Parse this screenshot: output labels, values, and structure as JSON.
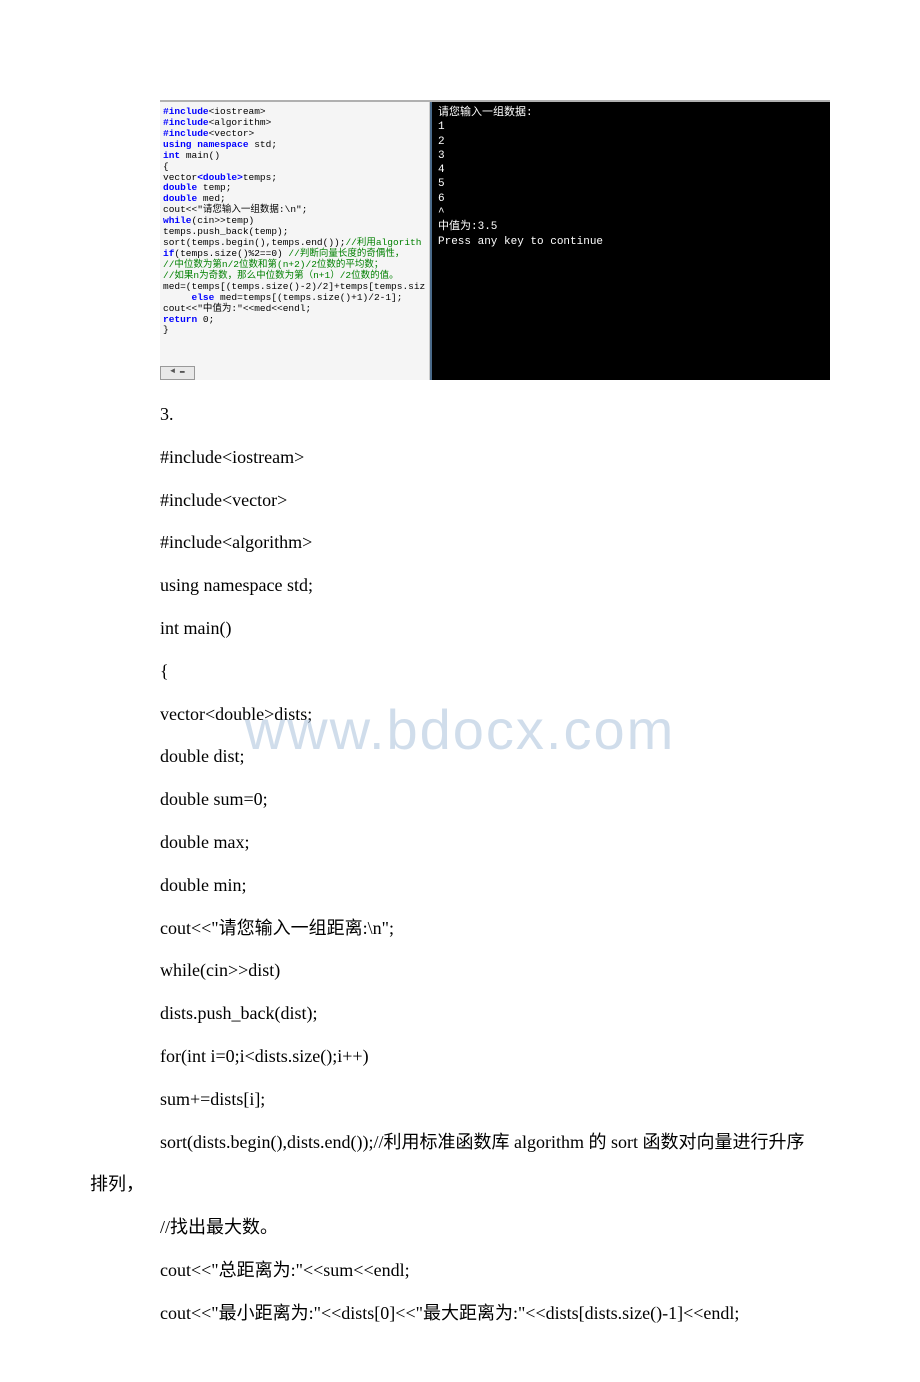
{
  "editor": {
    "l1a": "#include",
    "l1b": "<iostream>",
    "l2a": "#include",
    "l2b": "<algorithm>",
    "l3a": "#include",
    "l3b": "<vector>",
    "l4a": "using namespace ",
    "l4b": "std;",
    "l5a": "int ",
    "l5b": "main()",
    "l6": "{",
    "l7a": "vector",
    "l7b": "<double>",
    "l7c": "temps;",
    "l8a": "double ",
    "l8b": "temp;",
    "l9a": "double ",
    "l9b": "med;",
    "l10a": "cout<<",
    "l10b": "\"请您输入一组数据:\\n\"",
    "l10c": ";",
    "l11a": "while",
    "l11b": "(cin>>temp)",
    "l12": "temps.push_back(temp);",
    "l13a": "sort(temps.begin(),temps.end());",
    "l13b": "//利用algorith",
    "l14a": "if",
    "l14b": "(temps.size()%2==0)",
    "l14c": " //判断向量长度的奇偶性，",
    "l15": "//中位数为第n/2位数和第(n+2)/2位数的平均数；",
    "l16": "//如果n为奇数，那么中位数为第（n+1）/2位数的值。",
    "l17": "med=(temps[(temps.size()-2)/2]+temps[temps.siz",
    "l18a": "     else ",
    "l18b": "med=temps[(temps.size()+1)/2-1];",
    "l19a": "cout<<",
    "l19b": "\"中值为:\"",
    "l19c": "<<med<<endl;",
    "l20a": "return ",
    "l20b": "0;",
    "l21": "}"
  },
  "scroll_stub": "◄ ▬",
  "console": {
    "c1": "请您输入一组数据:",
    "c2": "1",
    "c3": "2",
    "c4": "3",
    "c5": "4",
    "c6": "5",
    "c7": "6",
    "c8": "^",
    "c9": "中值为:3.5",
    "c10": "Press any key to continue"
  },
  "body": {
    "p1": "3.",
    "p2": "#include<iostream>",
    "p3": "#include<vector>",
    "p4": "#include<algorithm>",
    "p5": "using namespace std;",
    "p6": "int main()",
    "p7": "{",
    "p8": "vector<double>dists;",
    "p9": "double dist;",
    "p10": "double sum=0;",
    "p11": "double max;",
    "p12": "double min;",
    "p13": "cout<<\"请您输入一组距离:\\n\";",
    "p14": "while(cin>>dist)",
    "p15": "dists.push_back(dist);",
    "p16": "for(int i=0;i<dists.size();i++)",
    "p17": "sum+=dists[i];",
    "p18": "sort(dists.begin(),dists.end());//利用标准函数库 algorithm 的 sort 函数对向量进行升序",
    "p18_hang": "排列，",
    "p19": "//找出最大数。",
    "p20": "cout<<\"总距离为:\"<<sum<<endl;",
    "p21": "cout<<\"最小距离为:\"<<dists[0]<<\"最大距离为:\"<<dists[dists.size()-1]<<endl;"
  },
  "watermark": "www.bdocx.com"
}
